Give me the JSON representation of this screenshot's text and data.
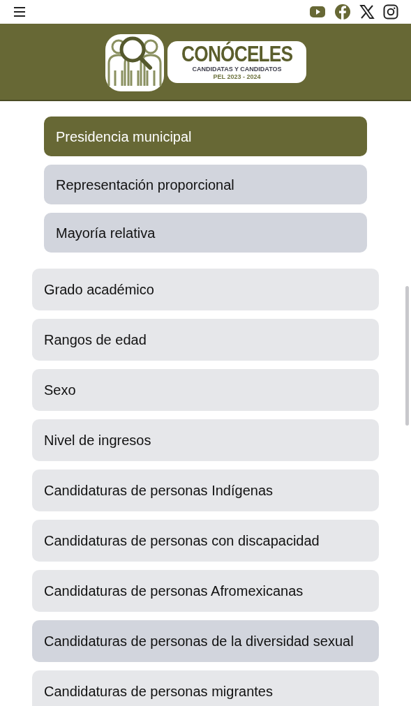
{
  "logo": {
    "title": "CONÓCELES",
    "subtitle": "CANDIDATAS Y CANDIDATOS",
    "period": "PEL 2023 - 2024"
  },
  "offices": [
    {
      "label": "Presidencia municipal",
      "selected": true
    },
    {
      "label": "Representación proporcional",
      "selected": false
    },
    {
      "label": "Mayoría relativa",
      "selected": false
    }
  ],
  "categories": [
    {
      "label": "Grado académico",
      "highlighted": false
    },
    {
      "label": "Rangos de edad",
      "highlighted": false
    },
    {
      "label": "Sexo",
      "highlighted": false
    },
    {
      "label": "Nivel de ingresos",
      "highlighted": false
    },
    {
      "label": "Candidaturas de personas Indígenas",
      "highlighted": false
    },
    {
      "label": "Candidaturas de personas con discapacidad",
      "highlighted": false
    },
    {
      "label": "Candidaturas de personas Afromexicanas",
      "highlighted": false
    },
    {
      "label": "Candidaturas de personas de la diversidad sexual",
      "highlighted": true
    },
    {
      "label": "Candidaturas de personas migrantes",
      "highlighted": false
    }
  ]
}
